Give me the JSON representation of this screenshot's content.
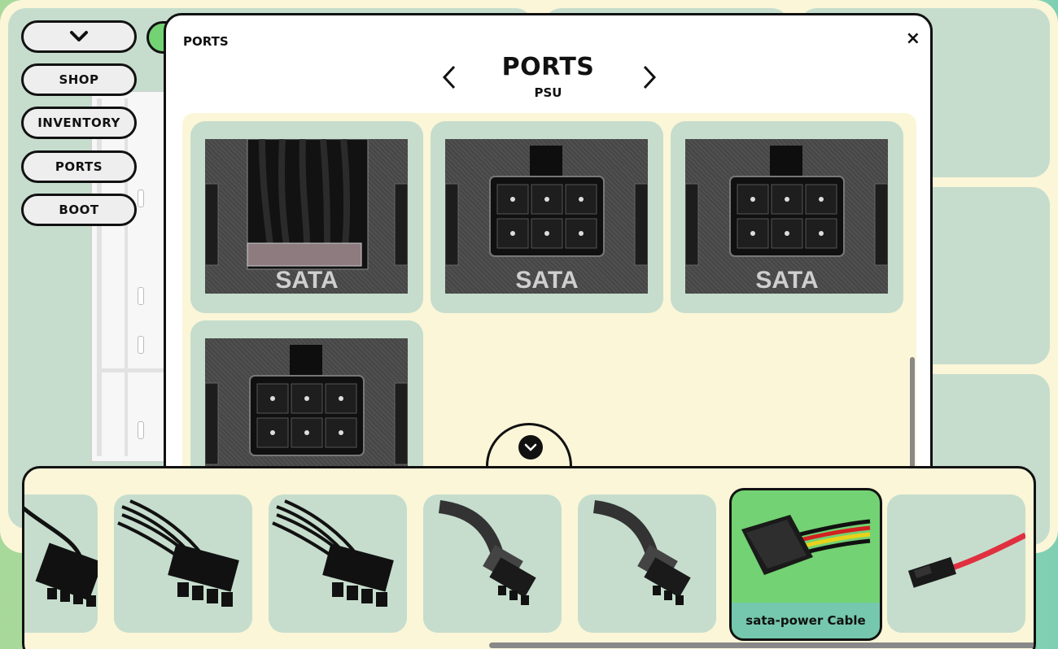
{
  "nav": {
    "toggle_icon": "chevron-down-icon",
    "items": [
      {
        "label": "SHOP"
      },
      {
        "label": "INVENTORY"
      },
      {
        "label": "PORTS"
      },
      {
        "label": "BOOT"
      }
    ]
  },
  "modal": {
    "corner_title": "PORTS",
    "close_label": "×",
    "title": "PORTS",
    "subtitle": "PSU",
    "prev_icon": "chevron-left-icon",
    "next_icon": "chevron-right-icon",
    "ports": [
      {
        "label": "SATA",
        "connected": true
      },
      {
        "label": "SATA",
        "connected": false
      },
      {
        "label": "SATA",
        "connected": false
      },
      {
        "label": "",
        "connected": false
      }
    ]
  },
  "tray": {
    "toggle_icon": "chevron-down-icon",
    "cables": [
      {
        "kind": "8pin",
        "label": ""
      },
      {
        "kind": "8pin",
        "label": ""
      },
      {
        "kind": "8pin",
        "label": ""
      },
      {
        "kind": "sleeved",
        "label": ""
      },
      {
        "kind": "sleeved",
        "label": ""
      },
      {
        "kind": "sata-power",
        "label": "sata-power Cable",
        "selected": true
      },
      {
        "kind": "sata-data",
        "label": ""
      }
    ]
  },
  "colors": {
    "background": "#fbf6d8",
    "card": "#c6ddcd",
    "accent": "#73d273",
    "label_bg": "#75c8ad"
  }
}
